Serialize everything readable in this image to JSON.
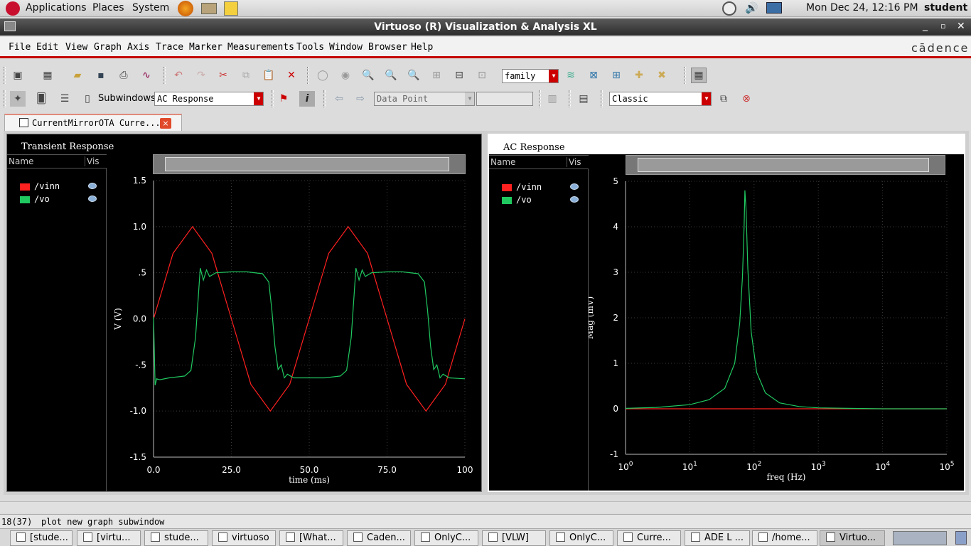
{
  "system_bar": {
    "applications": "Applications",
    "places": "Places",
    "system": "System",
    "datetime": "Mon Dec 24, 12:16 PM",
    "user": "student"
  },
  "window": {
    "title": "Virtuoso (R) Visualization & Analysis XL",
    "brand": "cādence"
  },
  "menu": [
    "File",
    "Edit",
    "View",
    "Graph",
    "Axis",
    "Trace",
    "Marker",
    "Measurements",
    "Tools",
    "Window",
    "Browser",
    "Help"
  ],
  "toolbar": {
    "family_value": "family",
    "subwindows_label": "Subwindows:",
    "subwindow_value": "AC Response",
    "data_point_value": "Data Point",
    "style_value": "Classic"
  },
  "tab": {
    "label": "CurrentMirrorOTA Curre...",
    "close": "×"
  },
  "legend_header": {
    "name": "Name",
    "vis": "Vis"
  },
  "colors": {
    "vinn": "#ff2020",
    "vo": "#20c860",
    "background": "#000000",
    "grid": "#3a3a3a"
  },
  "panels": {
    "transient": {
      "title": "Transient Response",
      "traces": [
        "/vinn",
        "/vo"
      ]
    },
    "ac": {
      "title": "AC Response",
      "traces": [
        "/vinn",
        "/vo"
      ]
    }
  },
  "chart_data": [
    {
      "type": "line",
      "title": "Transient Response",
      "xlabel": "time (ms)",
      "ylabel": "V (V)",
      "xlim": [
        0,
        100
      ],
      "ylim": [
        -1.5,
        1.5
      ],
      "x_ticks": [
        "0.0",
        "25.0",
        "50.0",
        "75.0",
        "100"
      ],
      "y_ticks": [
        "1.5",
        "1.0",
        ".5",
        "0.0",
        "-.5",
        "-1.0",
        "-1.5"
      ],
      "grid": true,
      "series": [
        {
          "name": "/vinn",
          "color": "#ff2020",
          "x": [
            0,
            6.25,
            12.5,
            18.75,
            25,
            31.25,
            37.5,
            43.75,
            50,
            56.25,
            62.5,
            68.75,
            75,
            81.25,
            87.5,
            93.75,
            100
          ],
          "y": [
            0,
            0.71,
            1.0,
            0.71,
            0,
            -0.71,
            -1.0,
            -0.71,
            0,
            0.71,
            1.0,
            0.71,
            0,
            -0.71,
            -1.0,
            -0.71,
            0
          ]
        },
        {
          "name": "/vo",
          "color": "#20c860",
          "x": [
            0,
            0.5,
            1,
            2,
            5,
            10,
            12,
            13.5,
            14.5,
            15,
            16,
            17,
            18,
            20,
            25,
            30,
            35,
            37,
            38,
            39,
            40,
            41,
            42,
            43,
            45,
            50,
            55,
            60,
            62,
            63.5,
            64.5,
            65,
            66,
            67,
            68,
            70,
            75,
            80,
            85,
            87,
            88,
            89,
            90,
            91,
            92,
            93,
            95,
            100
          ],
          "y": [
            0.02,
            -0.72,
            -0.65,
            -0.66,
            -0.64,
            -0.62,
            -0.56,
            -0.2,
            0.3,
            0.55,
            0.42,
            0.53,
            0.46,
            0.5,
            0.51,
            0.51,
            0.49,
            0.4,
            0.1,
            -0.3,
            -0.55,
            -0.5,
            -0.64,
            -0.6,
            -0.64,
            -0.64,
            -0.64,
            -0.62,
            -0.56,
            -0.2,
            0.3,
            0.55,
            0.42,
            0.53,
            0.46,
            0.5,
            0.51,
            0.51,
            0.49,
            0.4,
            0.1,
            -0.3,
            -0.55,
            -0.5,
            -0.64,
            -0.6,
            -0.64,
            -0.65
          ]
        }
      ]
    },
    {
      "type": "line",
      "title": "AC Response",
      "xlabel": "freq (Hz)",
      "ylabel": "Mag (mV)",
      "xscale": "log",
      "xlim": [
        1,
        100000
      ],
      "ylim": [
        -1,
        5
      ],
      "x_ticks": [
        "10^0",
        "10^1",
        "10^2",
        "10^3",
        "10^4",
        "10^5"
      ],
      "y_ticks": [
        "5",
        "4",
        "3",
        "2",
        "1",
        "0",
        "-1"
      ],
      "grid": true,
      "series": [
        {
          "name": "/vinn",
          "color": "#ff2020",
          "x": [
            1,
            10,
            100,
            1000,
            10000,
            100000
          ],
          "y": [
            0,
            0,
            0,
            0,
            0,
            0
          ]
        },
        {
          "name": "/vo",
          "color": "#20c860",
          "x": [
            1,
            3,
            10,
            20,
            35,
            50,
            60,
            66,
            70,
            72,
            75,
            80,
            90,
            110,
            150,
            250,
            500,
            1000,
            3000,
            10000,
            100000
          ],
          "y": [
            0.01,
            0.03,
            0.09,
            0.2,
            0.45,
            1.0,
            1.9,
            2.9,
            4.0,
            4.8,
            4.4,
            3.1,
            1.7,
            0.8,
            0.35,
            0.13,
            0.05,
            0.02,
            0.01,
            0.0,
            0.0
          ]
        }
      ]
    }
  ]
}
